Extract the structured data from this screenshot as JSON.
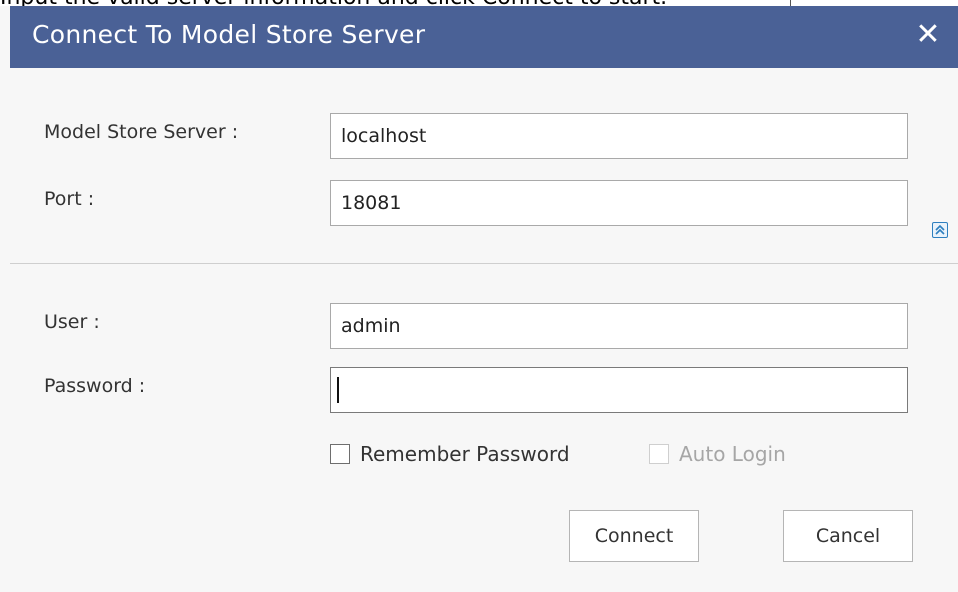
{
  "banner_text": "Input the valid server information and click Connect to start.",
  "dialog": {
    "title": "Connect To Model Store Server",
    "close_glyph": "✕"
  },
  "server": {
    "server_label": "Model Store Server :",
    "server_value": "localhost",
    "port_label": "Port :",
    "port_value": "18081"
  },
  "credentials": {
    "user_label": "User :",
    "user_value": "admin",
    "password_label": "Password :",
    "password_value": ""
  },
  "options": {
    "remember_label": "Remember Password",
    "auto_login_label": "Auto Login"
  },
  "buttons": {
    "connect_label": "Connect",
    "cancel_label": "Cancel"
  },
  "colors": {
    "titlebar": "#4a6196",
    "background": "#f7f7f7",
    "collapse_icon": "#2e7fbf"
  }
}
